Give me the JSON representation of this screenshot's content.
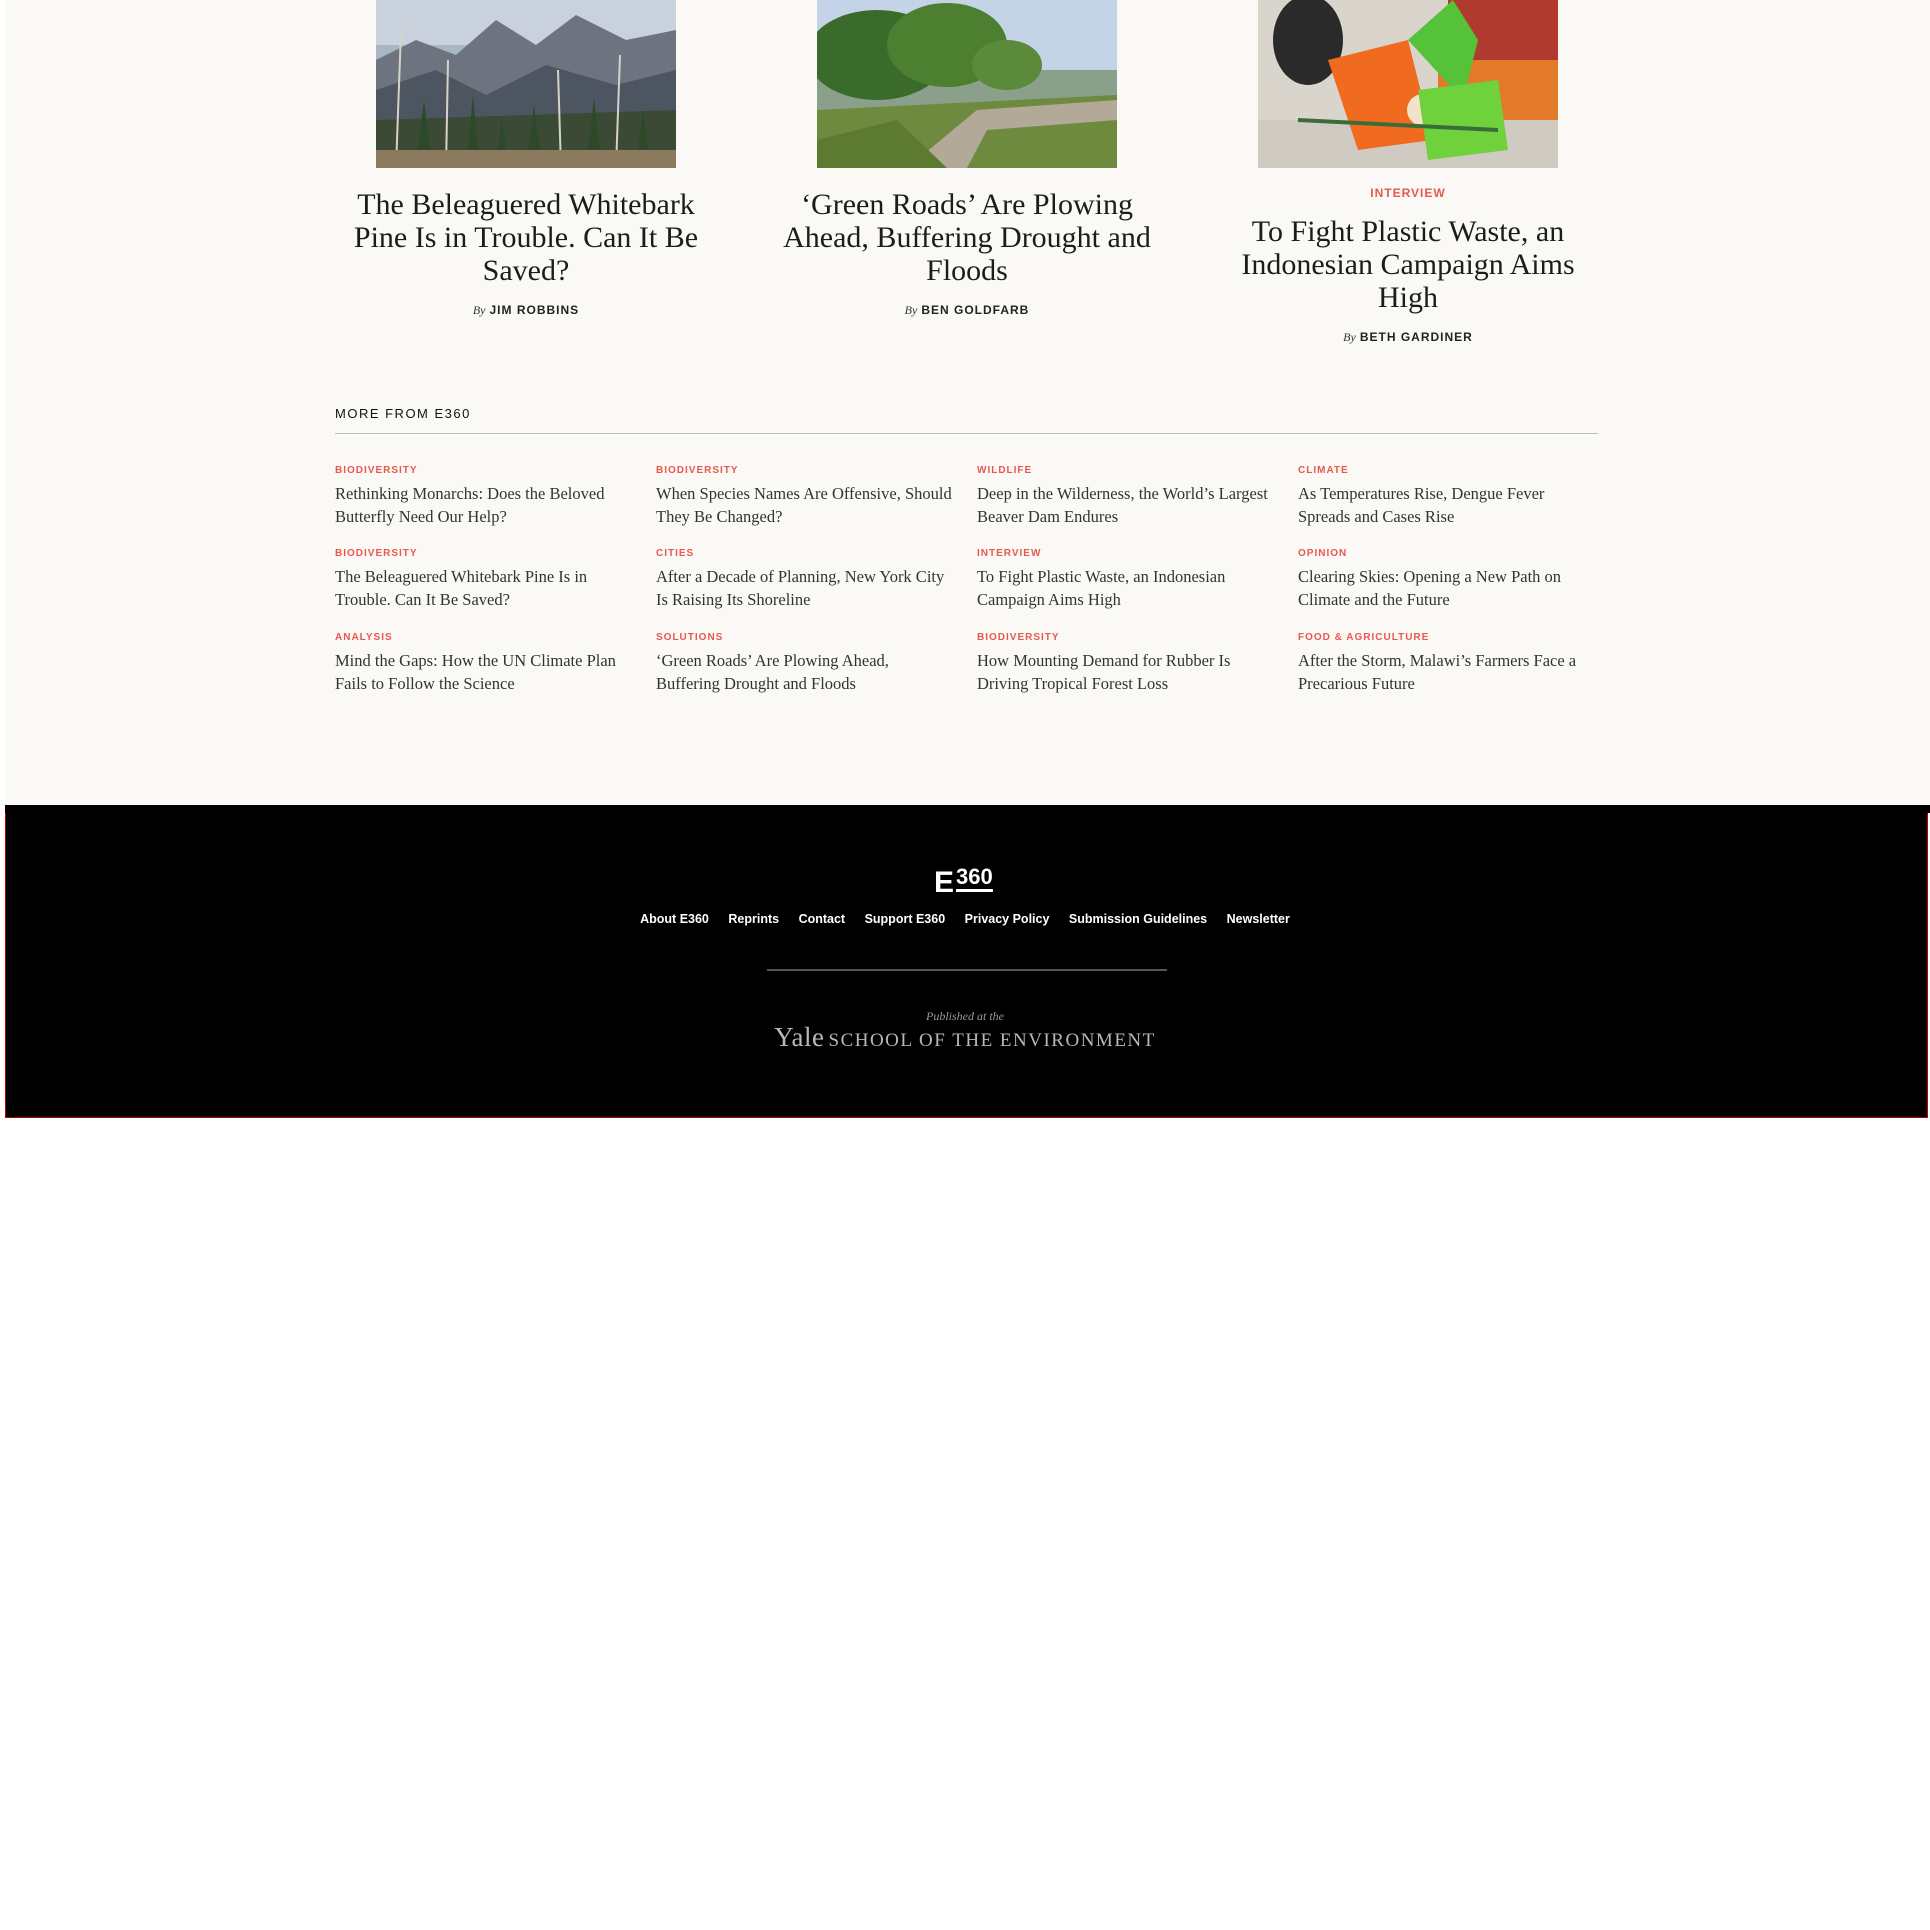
{
  "featured": [
    {
      "kicker": "",
      "title": "The Beleaguered Whitebark Pine Is in Trouble. Can It Be Saved?",
      "by": "By",
      "author": "JIM ROBBINS",
      "image": "mountain-forest-photo"
    },
    {
      "kicker": "",
      "title": "‘Green Roads’ Are Plowing Ahead, Buffering Drought and Floods",
      "by": "By",
      "author": "BEN GOLDFARB",
      "image": "tree-lined-road-photo"
    },
    {
      "kicker": "INTERVIEW",
      "title": "To Fight Plastic Waste, an Indonesian Campaign Aims High",
      "by": "By",
      "author": "BETH GARDINER",
      "image": "shopping-bags-photo"
    }
  ],
  "more": {
    "heading": "MORE FROM E360",
    "items": [
      {
        "cat": "BIODIVERSITY",
        "title": "Rethinking Monarchs: Does the Beloved Butterfly Need Our Help?"
      },
      {
        "cat": "BIODIVERSITY",
        "title": "When Species Names Are Offensive, Should They Be Changed?"
      },
      {
        "cat": "WILDLIFE",
        "title": "Deep in the Wilderness, the World’s Largest Beaver Dam Endures"
      },
      {
        "cat": "CLIMATE",
        "title": "As Temperatures Rise, Dengue Fever Spreads and Cases Rise"
      },
      {
        "cat": "BIODIVERSITY",
        "title": "The Beleaguered Whitebark Pine Is in Trouble. Can It Be Saved?"
      },
      {
        "cat": "CITIES",
        "title": "After a Decade of Planning, New York City Is Raising Its Shoreline"
      },
      {
        "cat": "INTERVIEW",
        "title": "To Fight Plastic Waste, an Indonesian Campaign Aims High"
      },
      {
        "cat": "OPINION",
        "title": "Clearing Skies: Opening a New Path on Climate and the Future"
      },
      {
        "cat": "ANALYSIS",
        "title": "Mind the Gaps: How the UN Climate Plan Fails to Follow the Science"
      },
      {
        "cat": "SOLUTIONS",
        "title": "‘Green Roads’ Are Plowing Ahead, Buffering Drought and Floods"
      },
      {
        "cat": "BIODIVERSITY",
        "title": "How Mounting Demand for Rubber Is Driving Tropical Forest Loss"
      },
      {
        "cat": "FOOD & AGRICULTURE",
        "title": "After the Storm, Malawi’s Farmers Face a Precarious Future"
      }
    ]
  },
  "footer": {
    "logo_e": "E",
    "logo_num": "360",
    "nav": [
      "About E360",
      "Reprints",
      "Contact",
      "Support E360",
      "Privacy Policy",
      "Submission Guidelines",
      "Newsletter"
    ],
    "published": "Published at the",
    "yale": "Yale",
    "school": "SCHOOL OF THE ENVIRONMENT"
  },
  "colors": {
    "accent": "#e8584f",
    "page_bg": "#faf9f5",
    "footer_bg": "#000000"
  }
}
